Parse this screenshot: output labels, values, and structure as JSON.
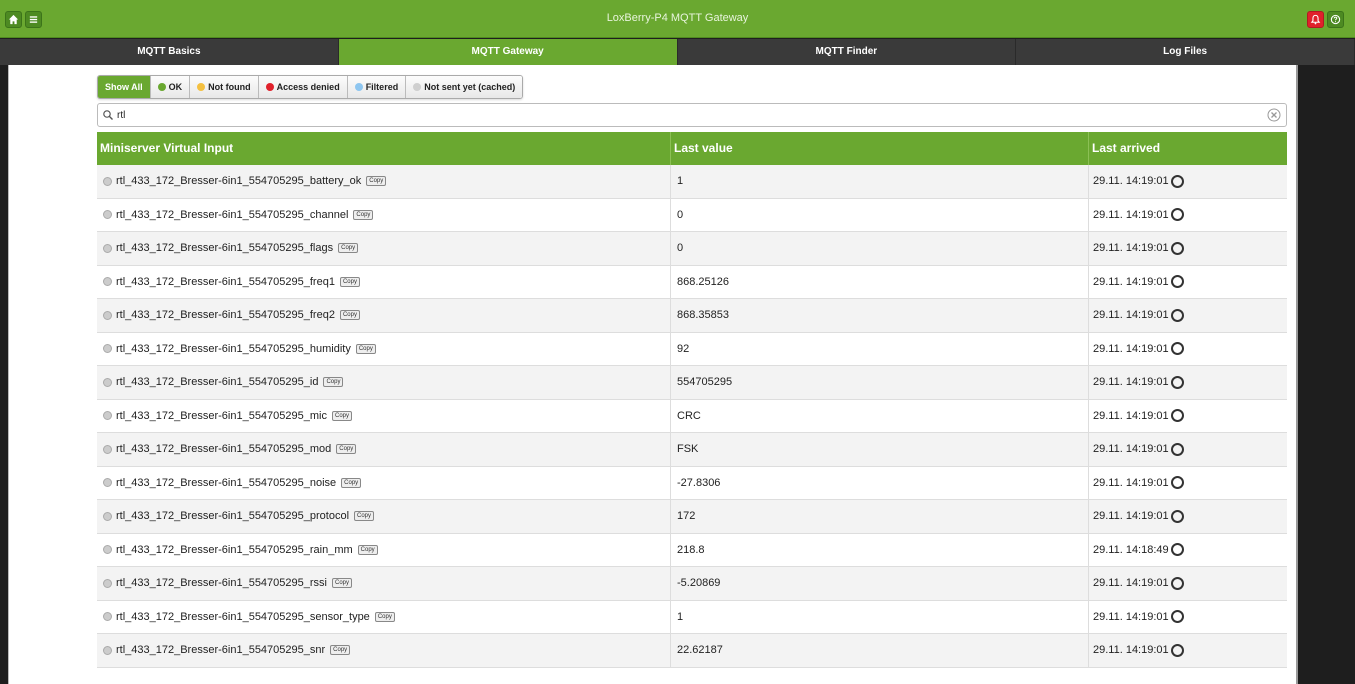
{
  "header": {
    "title": "LoxBerry-P4 MQTT Gateway",
    "home_icon": "home-icon",
    "menu_icon": "menu-icon",
    "notify_icon": "bell-icon",
    "help_icon": "help-icon",
    "accent": "#6aa830",
    "alert_color": "#e0212b"
  },
  "tabs": [
    {
      "label": "MQTT Basics",
      "active": false
    },
    {
      "label": "MQTT Gateway",
      "active": true
    },
    {
      "label": "MQTT Finder",
      "active": false
    },
    {
      "label": "Log Files",
      "active": false
    }
  ],
  "filters": {
    "show_all": "Show All",
    "ok": "OK",
    "not_found": "Not found",
    "access_denied": "Access denied",
    "filtered": "Filtered",
    "not_sent": "Not sent yet (cached)"
  },
  "search": {
    "value": "rtl"
  },
  "table": {
    "headers": {
      "input": "Miniserver Virtual Input",
      "value": "Last value",
      "arrived": "Last arrived"
    },
    "copy_label": "Copy",
    "rows": [
      {
        "input": "rtl_433_172_Bresser-6in1_554705295_battery_ok",
        "value": "1",
        "arrived": "29.11. 14:19:01"
      },
      {
        "input": "rtl_433_172_Bresser-6in1_554705295_channel",
        "value": "0",
        "arrived": "29.11. 14:19:01"
      },
      {
        "input": "rtl_433_172_Bresser-6in1_554705295_flags",
        "value": "0",
        "arrived": "29.11. 14:19:01"
      },
      {
        "input": "rtl_433_172_Bresser-6in1_554705295_freq1",
        "value": "868.25126",
        "arrived": "29.11. 14:19:01"
      },
      {
        "input": "rtl_433_172_Bresser-6in1_554705295_freq2",
        "value": "868.35853",
        "arrived": "29.11. 14:19:01"
      },
      {
        "input": "rtl_433_172_Bresser-6in1_554705295_humidity",
        "value": "92",
        "arrived": "29.11. 14:19:01"
      },
      {
        "input": "rtl_433_172_Bresser-6in1_554705295_id",
        "value": "554705295",
        "arrived": "29.11. 14:19:01"
      },
      {
        "input": "rtl_433_172_Bresser-6in1_554705295_mic",
        "value": "CRC",
        "arrived": "29.11. 14:19:01"
      },
      {
        "input": "rtl_433_172_Bresser-6in1_554705295_mod",
        "value": "FSK",
        "arrived": "29.11. 14:19:01"
      },
      {
        "input": "rtl_433_172_Bresser-6in1_554705295_noise",
        "value": "-27.8306",
        "arrived": "29.11. 14:19:01"
      },
      {
        "input": "rtl_433_172_Bresser-6in1_554705295_protocol",
        "value": "172",
        "arrived": "29.11. 14:19:01"
      },
      {
        "input": "rtl_433_172_Bresser-6in1_554705295_rain_mm",
        "value": "218.8",
        "arrived": "29.11. 14:18:49"
      },
      {
        "input": "rtl_433_172_Bresser-6in1_554705295_rssi",
        "value": "-5.20869",
        "arrived": "29.11. 14:19:01"
      },
      {
        "input": "rtl_433_172_Bresser-6in1_554705295_sensor_type",
        "value": "1",
        "arrived": "29.11. 14:19:01"
      },
      {
        "input": "rtl_433_172_Bresser-6in1_554705295_snr",
        "value": "22.62187",
        "arrived": "29.11. 14:19:01"
      }
    ]
  }
}
